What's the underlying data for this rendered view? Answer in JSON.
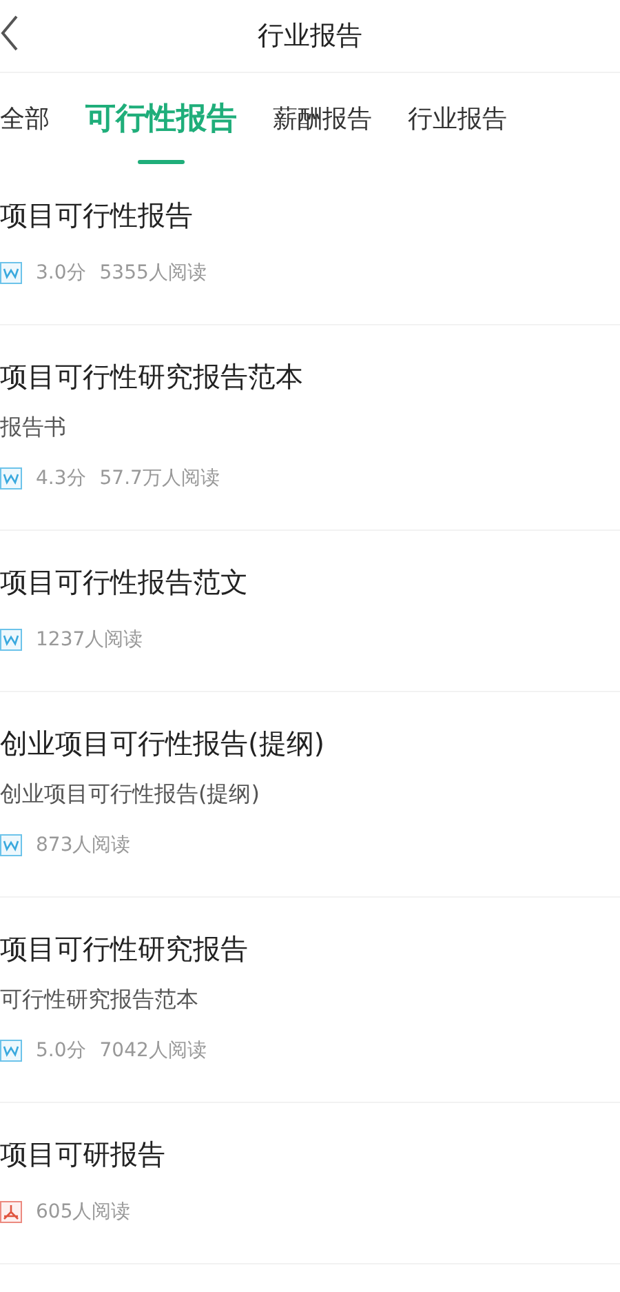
{
  "header": {
    "title": "行业报告"
  },
  "tabs": [
    {
      "label": "全部",
      "selected": false
    },
    {
      "label": "可行性报告",
      "selected": true
    },
    {
      "label": "薪酬报告",
      "selected": false
    },
    {
      "label": "行业报告",
      "selected": false
    }
  ],
  "documents": [
    {
      "title": "项目可行性报告",
      "kind": "word",
      "rating": "3.0分",
      "reads": "5355人阅读"
    },
    {
      "title": "项目可行性研究报告范本",
      "subtitle": "报告书",
      "kind": "word",
      "rating": "4.3分",
      "reads": "57.7万人阅读"
    },
    {
      "title": "项目可行性报告范文",
      "kind": "word",
      "reads": "1237人阅读"
    },
    {
      "title": "创业项目可行性报告(提纲)",
      "subtitle": "创业项目可行性报告(提纲)",
      "kind": "word",
      "reads": "873人阅读"
    },
    {
      "title": "项目可行性研究报告",
      "subtitle": "可行性研究报告范本",
      "kind": "word",
      "rating": "5.0分",
      "reads": "7042人阅读"
    },
    {
      "title": "项目可研报告",
      "kind": "pdf",
      "reads": "605人阅读"
    }
  ]
}
